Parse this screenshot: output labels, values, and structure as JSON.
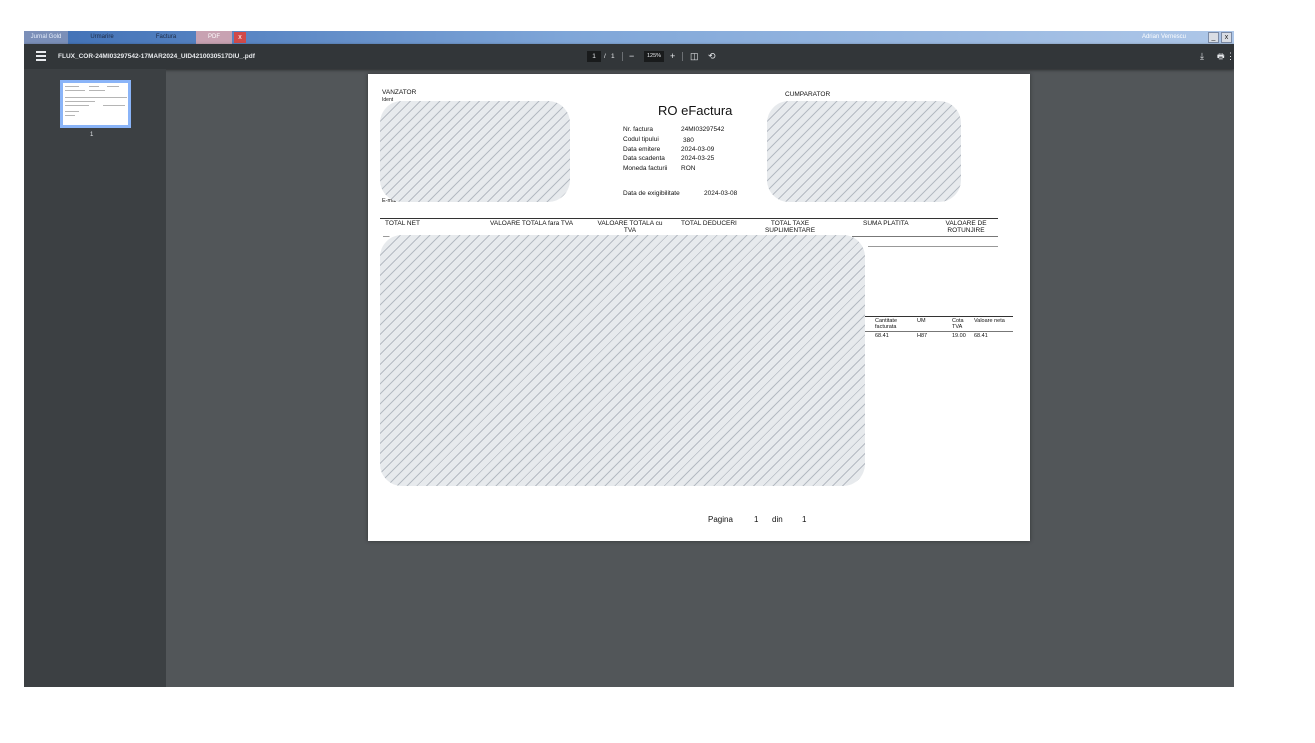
{
  "app_tabs": [
    {
      "label": "Jurnal Gold"
    },
    {
      "label": "Urmarire"
    },
    {
      "label": "Factura"
    },
    {
      "label": "PDF"
    }
  ],
  "tab_close_label": "x",
  "user_name": "Adrian Vernescu",
  "window_buttons": {
    "minimize": "_",
    "close": "x"
  },
  "viewer": {
    "file_name": "FLUX_COR-24MI03297542-17MAR2024_UID4210030517DIU_.pdf",
    "current_page": "1",
    "page_sep": "/",
    "total_pages": "1",
    "zoom_minus": "−",
    "zoom_level": "125%",
    "zoom_plus": "+",
    "fit_icon": "◫",
    "rotate_icon": "⟲",
    "download_icon": "⤓",
    "print_icon": "🖶",
    "more_icon": "⋮"
  },
  "sidebar": {
    "thumb_number": "1"
  },
  "document": {
    "seller_label": "VANZATOR",
    "seller_id_partial": "Ident",
    "seller_email_partial": "E-mai",
    "buyer_label": "CUMPARATOR",
    "title": "RO eFactura",
    "fields": [
      {
        "label": "Nr. factura",
        "value": "24MI03297542"
      },
      {
        "label": "Codul tipului",
        "value": "380"
      },
      {
        "label": "Data emitere",
        "value": "2024-03-09"
      },
      {
        "label": "Data scadenta",
        "value": "2024-03-25"
      },
      {
        "label": "Moneda facturii",
        "value": "RON"
      }
    ],
    "exig_label": "Data de exigibilitate",
    "exig_value": "2024-03-08",
    "totals_headers": [
      "TOTAL NET",
      "VALOARE TOTALA fara TVA",
      "VALOARE TOTALA cu TVA",
      "TOTAL DEDUCERI",
      "TOTAL TAXE SUPLIMENTARE",
      "SUMA PLATITA",
      "VALOARE DE ROTUNJIRE"
    ],
    "totals_net_partial": "—",
    "line_headers": [
      "Cantitate facturata",
      "UM",
      "Cota TVA",
      "Valoare neta"
    ],
    "line_values": [
      "68.41",
      "H87",
      "19.00",
      "68.41"
    ],
    "footer": {
      "page_label": "Pagina",
      "page_num": "1",
      "of_label": "din",
      "page_total": "1"
    }
  }
}
